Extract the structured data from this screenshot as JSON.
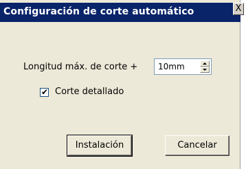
{
  "dialog": {
    "title": "Configuración de corte automático",
    "close_label": "X"
  },
  "form": {
    "max_length_label": "Longitud máx. de corte +",
    "max_length_value": "10mm",
    "detailed_cut_label": "Corte detallado",
    "detailed_cut_checked": true,
    "checkmark_glyph": "✔"
  },
  "buttons": {
    "install_label": "Instalación",
    "cancel_label": "Cancelar"
  }
}
